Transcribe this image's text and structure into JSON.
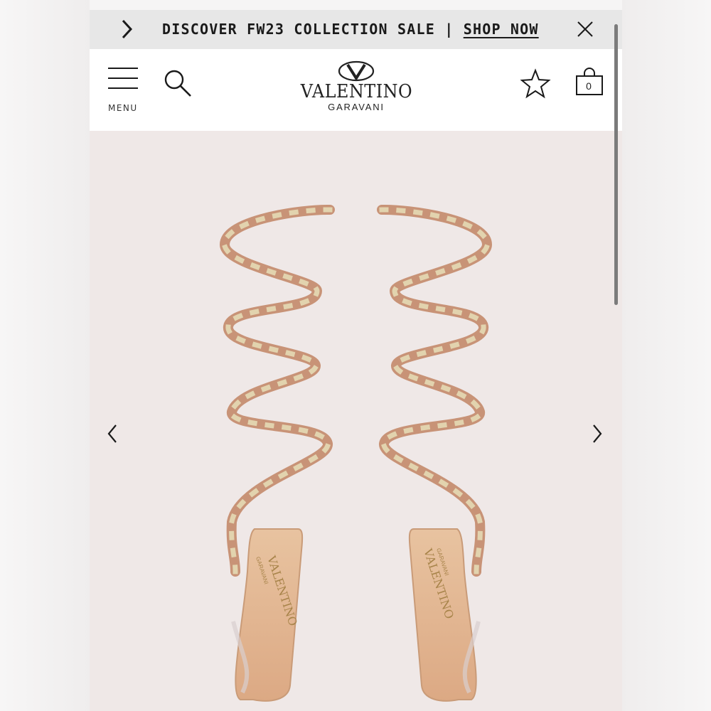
{
  "promo": {
    "text": "DISCOVER FW23 COLLECTION SALE | ",
    "link": "SHOP NOW"
  },
  "header": {
    "menu_label": "MENU",
    "brand_name": "VALENTINO",
    "brand_sub": "GARAVANI",
    "cart_count": "0"
  },
  "icons": {
    "promo_prev": "chevron-right-icon",
    "promo_close": "close-icon",
    "menu": "hamburger-icon",
    "search": "search-icon",
    "wishlist": "star-icon",
    "cart": "shopping-bag-icon",
    "gallery_prev": "chevron-left-icon",
    "gallery_next": "chevron-right-icon"
  },
  "colors": {
    "promo_bg": "#e7e7e7",
    "header_bg": "#ffffff",
    "gallery_bg": "#efe8e7",
    "strap": "#c89377",
    "stud": "#d9c8a4"
  }
}
